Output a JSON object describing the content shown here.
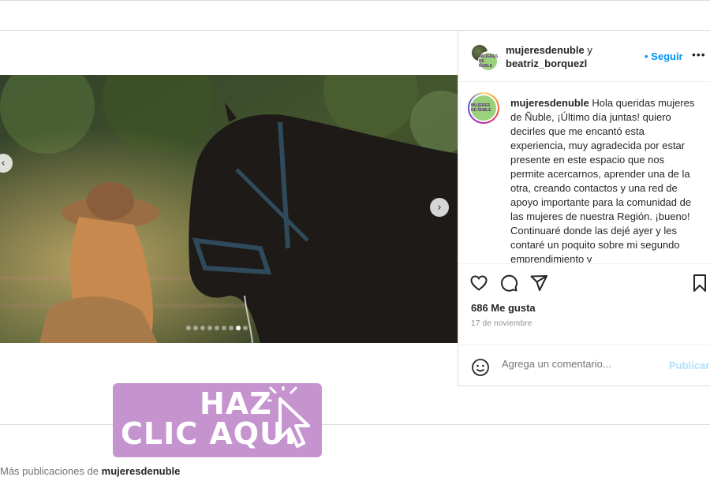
{
  "post": {
    "header": {
      "user1": "mujeresdenuble",
      "conjunction": "y",
      "user2": "beatriz_borquezl",
      "follow_label": "• Seguir",
      "more_icon": "more-icon"
    },
    "avatar_text": "MUJERES DE ÑUBLE",
    "caption": {
      "username": "mujeresdenuble",
      "text": "Hola queridas mujeres de Ñuble, ¡Último día juntas! quiero decirles que me encantó esta experiencia, muy agradecida por estar presente en este espacio que nos permite acercarnos, aprender una de la otra, creando contactos y una red de apoyo importante para la comunidad de las mujeres de nuestra Región. ¡bueno! Continuaré donde las dejé ayer y les contaré un poquito sobre mi segundo emprendimiento y"
    },
    "likes": "686 Me gusta",
    "date": "17 de noviembre",
    "comment_placeholder": "Agrega un comentario...",
    "publish_label": "Publicar",
    "carousel": {
      "total": 9,
      "active": 7,
      "prev_icon": "‹",
      "next_icon": "›"
    }
  },
  "banner": {
    "line1": "HAZ",
    "line2": "CLIC AQUÍ",
    "color": "#c594cf"
  },
  "footer": {
    "prefix": "Más publicaciones de",
    "username": "mujeresdenuble"
  },
  "colors": {
    "link": "#0095f6",
    "border": "#dbdbdb",
    "muted": "#8e8e8e"
  }
}
